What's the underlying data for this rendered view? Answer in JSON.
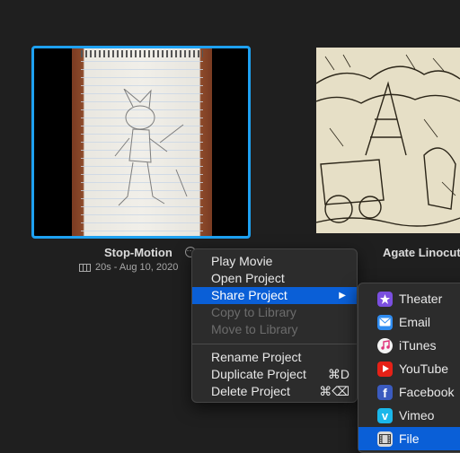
{
  "projects": [
    {
      "title": "Stop-Motion",
      "meta": "20s - Aug 10, 2020",
      "selected": true
    },
    {
      "title": "Agate Linocut",
      "selected": false
    }
  ],
  "context_menu": {
    "items": [
      {
        "label": "Play Movie"
      },
      {
        "label": "Open Project"
      },
      {
        "label": "Share Project",
        "submenu_arrow": "▶"
      },
      {
        "label": "Copy to Library",
        "disabled": true
      },
      {
        "label": "Move to Library",
        "disabled": true
      },
      {
        "label": "Rename Project"
      },
      {
        "label": "Duplicate Project",
        "shortcut": "⌘D"
      },
      {
        "label": "Delete Project",
        "shortcut": "⌘⌫"
      }
    ]
  },
  "share_menu": {
    "items": [
      {
        "label": "Theater",
        "icon": "theater-icon",
        "color": "#7b4fe0"
      },
      {
        "label": "Email",
        "icon": "email-icon",
        "color": "#2f8cf0"
      },
      {
        "label": "iTunes",
        "icon": "itunes-icon",
        "color": "#f4f4f4"
      },
      {
        "label": "YouTube",
        "icon": "youtube-icon",
        "color": "#e62117"
      },
      {
        "label": "Facebook",
        "icon": "facebook-icon",
        "color": "#3b5bbf"
      },
      {
        "label": "Vimeo",
        "icon": "vimeo-icon",
        "color": "#1ab7ea"
      },
      {
        "label": "File",
        "icon": "file-icon",
        "color": "#d8d8d8"
      }
    ]
  },
  "colors": {
    "selection": "#1ea1f1",
    "menu_highlight": "#0a5fd7"
  }
}
